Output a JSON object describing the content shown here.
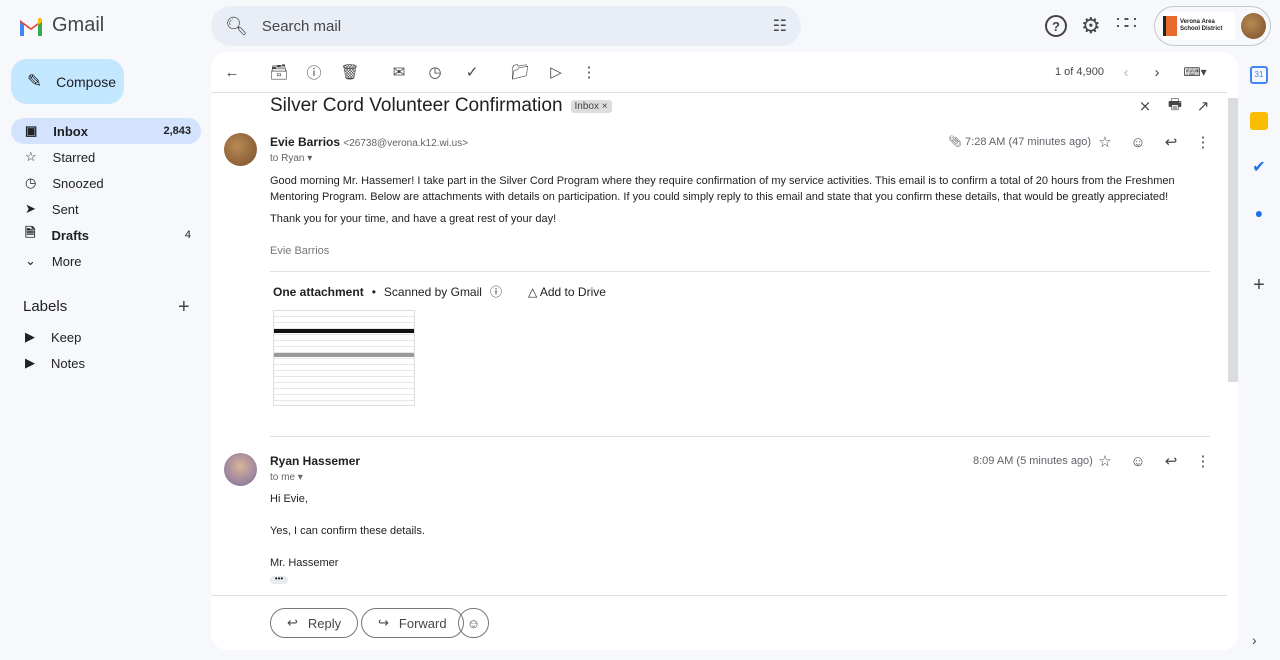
{
  "app": {
    "name": "Gmail"
  },
  "search": {
    "placeholder": "Search mail"
  },
  "account": {
    "org_line1": "Verona Area",
    "org_line2": "School District"
  },
  "sidebar": {
    "compose": "Compose",
    "items": [
      {
        "label": "Inbox",
        "count": "2,843",
        "icon": "inbox-icon"
      },
      {
        "label": "Starred",
        "count": "",
        "icon": "star-icon"
      },
      {
        "label": "Snoozed",
        "count": "",
        "icon": "clock-icon"
      },
      {
        "label": "Sent",
        "count": "",
        "icon": "send-icon"
      },
      {
        "label": "Drafts",
        "count": "4",
        "icon": "draft-icon"
      },
      {
        "label": "More",
        "count": "",
        "icon": "chevron-down-icon"
      }
    ],
    "labels_title": "Labels",
    "labels": [
      "Keep",
      "Notes"
    ]
  },
  "toolbar": {
    "pagination": "1 of 4,900"
  },
  "thread": {
    "subject": "Silver Cord Volunteer Confirmation",
    "label": "Inbox",
    "messages": [
      {
        "sender": "Evie Barrios",
        "email": "<26738@verona.k12.wi.us>",
        "to": "to Ryan",
        "time": "7:28 AM (47 minutes ago)",
        "body": [
          "Good morning Mr. Hassemer! I take part in the Silver Cord Program where they require confirmation of my service activities. This email is to confirm a total of 20 hours from the Freshmen Mentoring Program. Below are attachments with details on participation. If you could simply reply to this email and state that you confirm these details, that would be greatly appreciated!",
          "Thank you for your time, and have a great rest of your day!"
        ],
        "signature": "Evie Barrios",
        "attachment": {
          "title": "One attachment",
          "scanned": "Scanned by Gmail",
          "add_drive": "Add to Drive"
        }
      },
      {
        "sender": "Ryan Hassemer",
        "to": "to me",
        "time": "8:09 AM (5 minutes ago)",
        "body": [
          "Hi Evie,",
          "Yes, I can confirm these details.",
          "Mr. Hassemer"
        ]
      }
    ],
    "actions": {
      "reply": "Reply",
      "forward": "Forward"
    }
  },
  "rail": {
    "calendar_day": "31"
  },
  "colors": {
    "accent": "#0b57d0",
    "nav_active": "#d3e3fd",
    "compose": "#c2e7ff",
    "bg": "#f6f8fc"
  }
}
